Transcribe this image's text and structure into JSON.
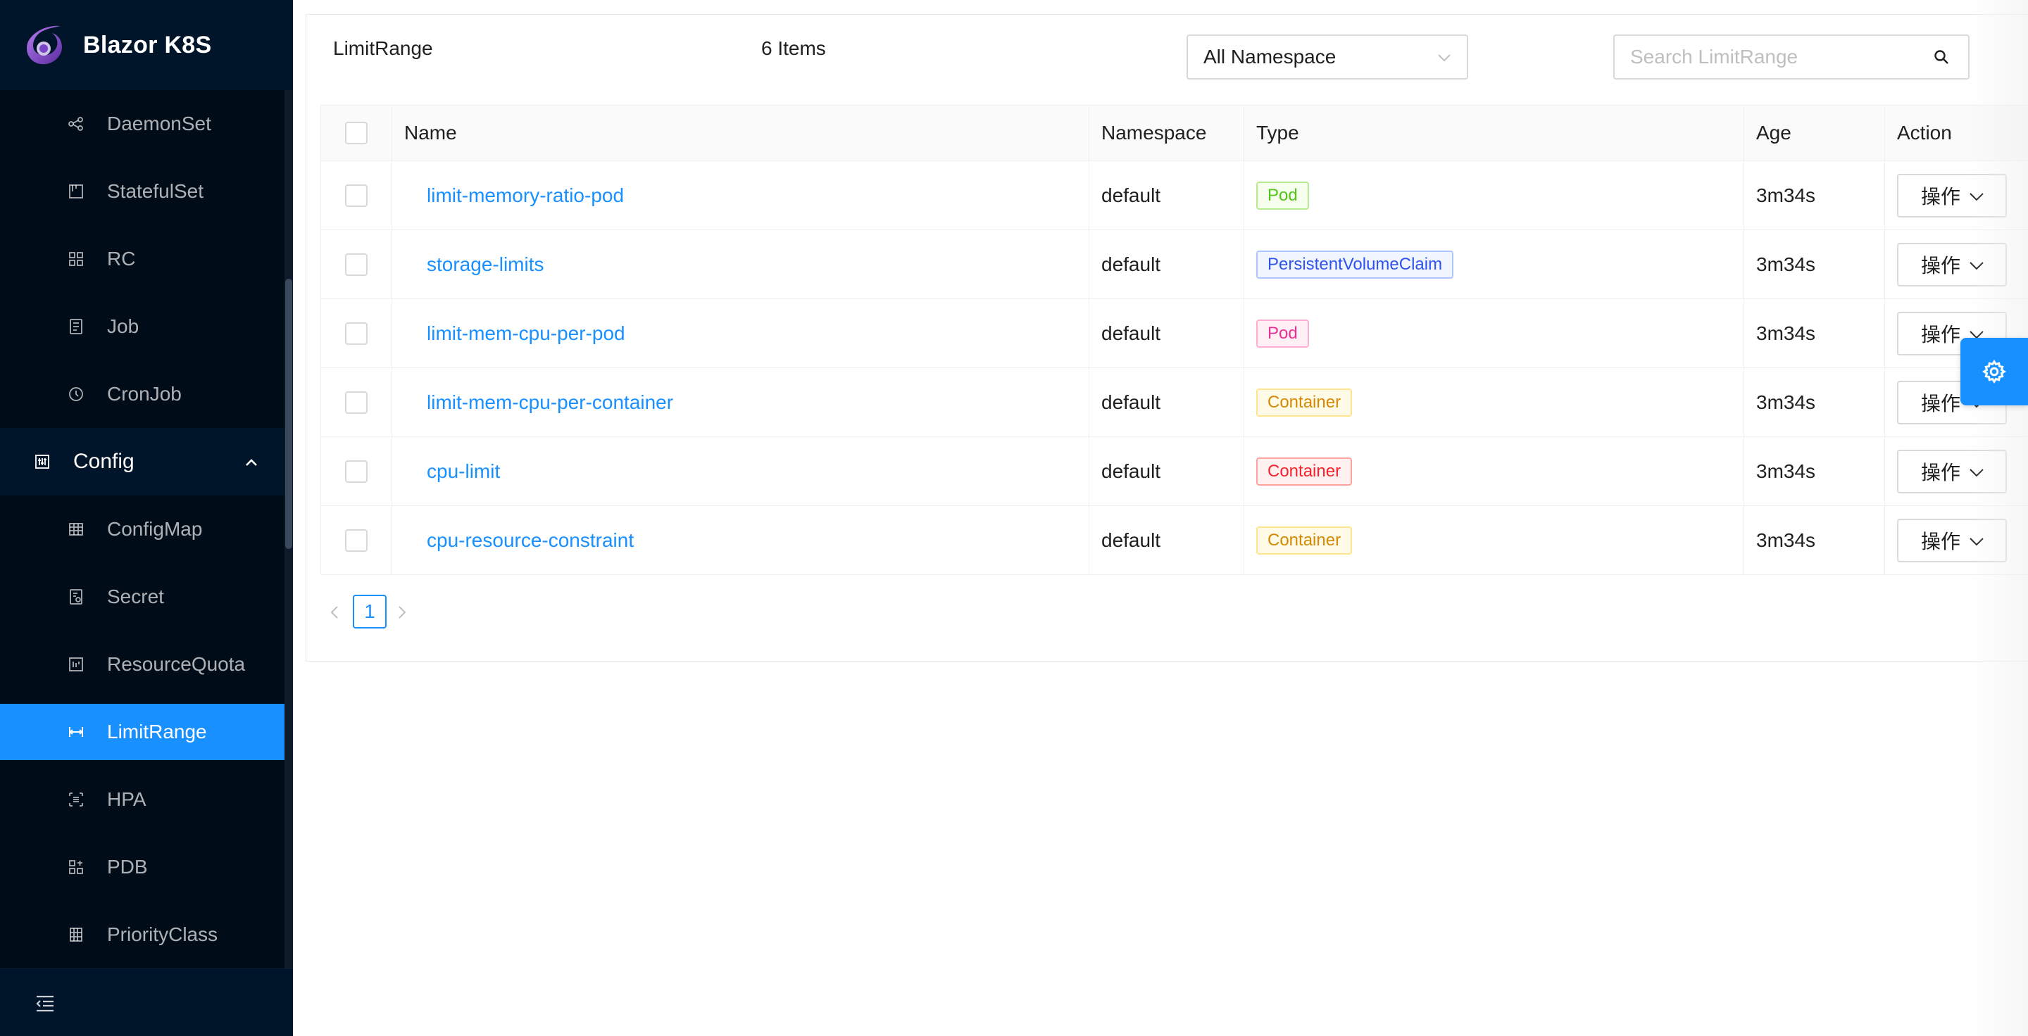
{
  "brand": {
    "title": "Blazor K8S"
  },
  "sidebar": {
    "items_top": [
      {
        "label": "DaemonSet",
        "icon": "daemonset-icon"
      },
      {
        "label": "StatefulSet",
        "icon": "statefulset-icon"
      },
      {
        "label": "RC",
        "icon": "rc-icon"
      },
      {
        "label": "Job",
        "icon": "job-icon"
      },
      {
        "label": "CronJob",
        "icon": "cronjob-icon"
      }
    ],
    "group": {
      "label": "Config",
      "expanded": true
    },
    "items_config": [
      {
        "label": "ConfigMap",
        "icon": "configmap-icon"
      },
      {
        "label": "Secret",
        "icon": "secret-icon"
      },
      {
        "label": "ResourceQuota",
        "icon": "resourcequota-icon"
      },
      {
        "label": "LimitRange",
        "icon": "limitrange-icon",
        "active": true
      },
      {
        "label": "HPA",
        "icon": "hpa-icon"
      },
      {
        "label": "PDB",
        "icon": "pdb-icon"
      },
      {
        "label": "PriorityClass",
        "icon": "priorityclass-icon"
      }
    ]
  },
  "toolbar": {
    "title": "LimitRange",
    "count": "6 Items",
    "namespace_select": "All Namespace",
    "search_placeholder": "Search LimitRange"
  },
  "table": {
    "headers": {
      "name": "Name",
      "namespace": "Namespace",
      "type": "Type",
      "age": "Age",
      "action": "Action"
    },
    "rows": [
      {
        "name": "limit-memory-ratio-pod",
        "namespace": "default",
        "type": "Pod",
        "type_color": "green",
        "age": "3m34s",
        "action": "操作"
      },
      {
        "name": "storage-limits",
        "namespace": "default",
        "type": "PersistentVolumeClaim",
        "type_color": "blue",
        "age": "3m34s",
        "action": "操作"
      },
      {
        "name": "limit-mem-cpu-per-pod",
        "namespace": "default",
        "type": "Pod",
        "type_color": "magenta",
        "age": "3m34s",
        "action": "操作"
      },
      {
        "name": "limit-mem-cpu-per-container",
        "namespace": "default",
        "type": "Container",
        "type_color": "gold",
        "age": "3m34s",
        "action": "操作"
      },
      {
        "name": "cpu-limit",
        "namespace": "default",
        "type": "Container",
        "type_color": "red",
        "age": "3m34s",
        "action": "操作"
      },
      {
        "name": "cpu-resource-constraint",
        "namespace": "default",
        "type": "Container",
        "type_color": "gold",
        "age": "3m34s",
        "action": "操作"
      }
    ]
  },
  "pagination": {
    "current": "1"
  },
  "colors": {
    "accent": "#1890ff",
    "sidebar_bg": "#001529",
    "menu_bg": "#000c17"
  }
}
